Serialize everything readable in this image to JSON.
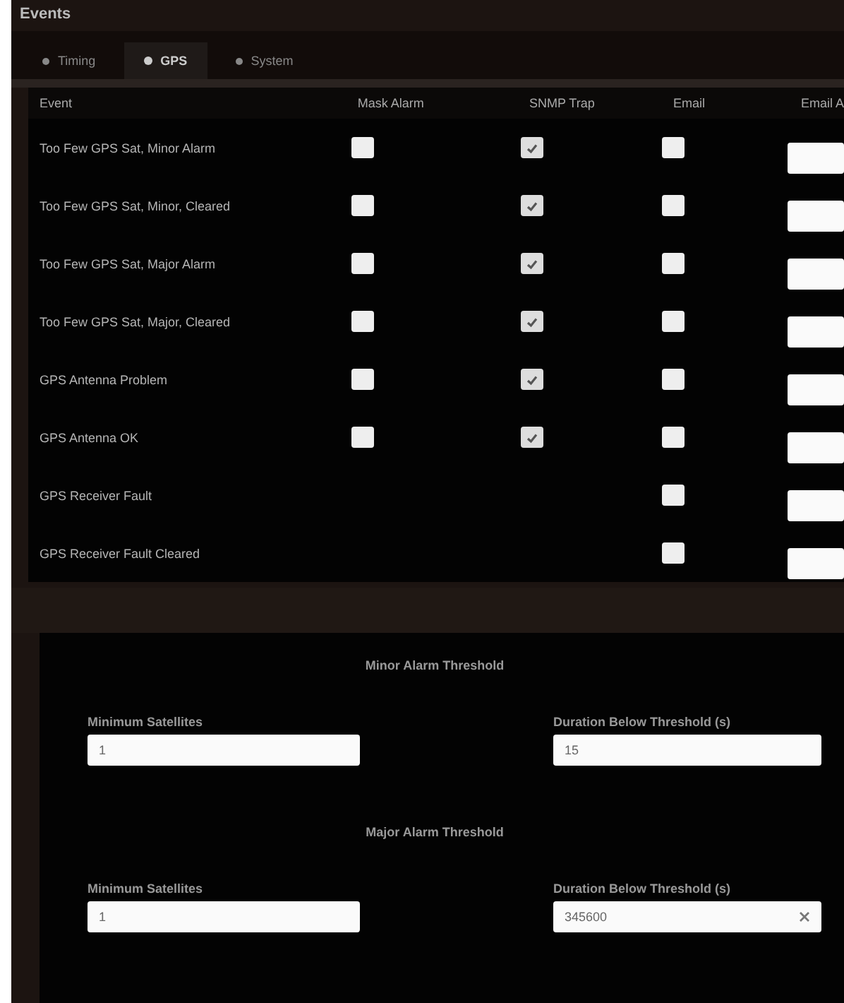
{
  "title": "Events",
  "tabs": [
    {
      "label": "Timing",
      "selected": false
    },
    {
      "label": "GPS",
      "selected": true
    },
    {
      "label": "System",
      "selected": false
    }
  ],
  "table": {
    "columns": [
      "Event",
      "Mask Alarm",
      "SNMP Trap",
      "Email",
      "Email A"
    ],
    "rows": [
      {
        "event": "Too Few GPS Sat, Minor Alarm",
        "mask_alarm": false,
        "snmp_trap": true,
        "email": false
      },
      {
        "event": "Too Few GPS Sat, Minor, Cleared",
        "mask_alarm": false,
        "snmp_trap": true,
        "email": false
      },
      {
        "event": "Too Few GPS Sat, Major Alarm",
        "mask_alarm": false,
        "snmp_trap": true,
        "email": false
      },
      {
        "event": "Too Few GPS Sat, Major, Cleared",
        "mask_alarm": false,
        "snmp_trap": true,
        "email": false
      },
      {
        "event": "GPS Antenna Problem",
        "mask_alarm": false,
        "snmp_trap": true,
        "email": false
      },
      {
        "event": "GPS Antenna OK",
        "mask_alarm": false,
        "snmp_trap": true,
        "email": false
      },
      {
        "event": "GPS Receiver Fault",
        "email": false
      },
      {
        "event": "GPS Receiver Fault Cleared",
        "email": false
      }
    ]
  },
  "thresholds": [
    {
      "title": "Minor Alarm Threshold",
      "fields": [
        {
          "label": "Minimum Satellites",
          "value": "1"
        },
        {
          "label": "Duration Below Threshold (s)",
          "value": "15"
        }
      ]
    },
    {
      "title": "Major Alarm Threshold",
      "fields": [
        {
          "label": "Minimum Satellites",
          "value": "1"
        },
        {
          "label": "Duration Below Threshold (s)",
          "value": "345600",
          "clearable": true
        }
      ]
    }
  ]
}
